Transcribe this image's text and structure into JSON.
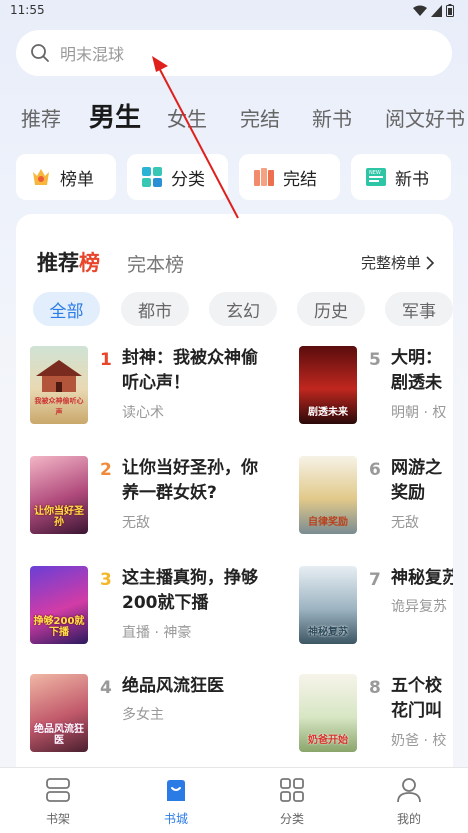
{
  "status": {
    "time": "11:55"
  },
  "search": {
    "placeholder": "明末混球"
  },
  "tabs": [
    {
      "label": "推荐",
      "active": false
    },
    {
      "label": "男生",
      "active": true
    },
    {
      "label": "女生",
      "active": false
    },
    {
      "label": "完结",
      "active": false
    },
    {
      "label": "新书",
      "active": false
    },
    {
      "label": "阅文好书",
      "active": false
    }
  ],
  "quick": [
    {
      "label": "榜单",
      "icon": "crown-icon"
    },
    {
      "label": "分类",
      "icon": "grid-icon"
    },
    {
      "label": "完结",
      "icon": "books-icon"
    },
    {
      "label": "新书",
      "icon": "new-book-icon"
    }
  ],
  "ranking": {
    "title_a": "推荐",
    "title_b": "榜",
    "alt_title": "完本榜",
    "full_label": "完整榜单",
    "chips": [
      "全部",
      "都市",
      "玄幻",
      "历史",
      "军事"
    ],
    "books": [
      {
        "rank": "1",
        "title": "封神：我被众神偷听心声！",
        "tag": "读心术",
        "cover_text": "我被众神偷听心声"
      },
      {
        "rank": "2",
        "title": "让你当好圣孙，你养一群女妖?",
        "tag": "无敌",
        "cover_text": "让你当好圣孙"
      },
      {
        "rank": "3",
        "title": "这主播真狗，挣够200就下播",
        "tag": "直播 · 神豪",
        "cover_text": "挣够200就下播"
      },
      {
        "rank": "4",
        "title": "绝品风流狂医",
        "tag": "多女主",
        "cover_text": "绝品风流狂医"
      },
      {
        "rank": "5",
        "title": "大明：剧透未来，朱元",
        "tag": "明朝 · 权",
        "cover_text": "剧透未来"
      },
      {
        "rank": "6",
        "title": "网游之奖励",
        "tag": "无敌",
        "cover_text": "自律奖励"
      },
      {
        "rank": "7",
        "title": "神秘复苏",
        "tag": "诡异复苏",
        "cover_text": "神秘复苏"
      },
      {
        "rank": "8",
        "title": "五个校花门叫我",
        "tag": "奶爸 · 校",
        "cover_text": "奶爸开始"
      }
    ]
  },
  "nav": [
    {
      "label": "书架",
      "icon": "bookshelf-icon",
      "active": false
    },
    {
      "label": "书城",
      "icon": "bookstore-icon",
      "active": true
    },
    {
      "label": "分类",
      "icon": "category-icon",
      "active": false
    },
    {
      "label": "我的",
      "icon": "profile-icon",
      "active": false
    }
  ],
  "colors": {
    "accent": "#2b7be6",
    "rank_red": "#e8452b",
    "rank_orange": "#f08a3a",
    "rank_yellow": "#f4b62a",
    "rank_grey": "#999999"
  }
}
